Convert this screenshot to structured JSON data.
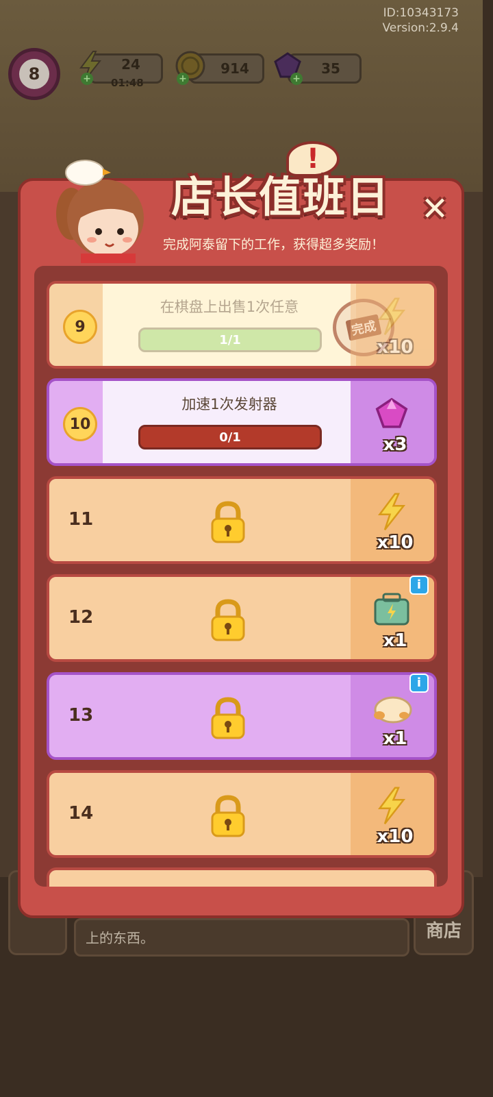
{
  "meta": {
    "id": "ID:10343173",
    "version": "Version:2.9.4"
  },
  "top_bar": {
    "level": "8",
    "energy": "24",
    "energy_timer": "01:48",
    "coins": "914",
    "gems": "35"
  },
  "panel": {
    "title": "店长值班日",
    "subtitle": "完成阿泰留下的工作，获得超多奖励！",
    "alert": "!",
    "close_label": "✕"
  },
  "tasks": [
    {
      "number": "9",
      "description": "在棋盘上出售1次任意",
      "progress": "1/1",
      "progress_fraction": 1.0,
      "status": "完成",
      "reward_icon": "energy-icon",
      "reward_qty": "x10"
    },
    {
      "number": "10",
      "description": "加速1次发射器",
      "progress": "0/1",
      "progress_fraction": 0.0,
      "reward_icon": "gem-icon",
      "reward_qty": "x3"
    },
    {
      "number": "11",
      "locked": true,
      "reward_icon": "energy-icon",
      "reward_qty": "x10"
    },
    {
      "number": "12",
      "locked": true,
      "reward_icon": "energy-chest-icon",
      "reward_qty": "x1"
    },
    {
      "number": "13",
      "locked": true,
      "reward_icon": "bread-icon",
      "reward_qty": "x1"
    },
    {
      "number": "14",
      "locked": true,
      "reward_icon": "energy-icon",
      "reward_qty": "x10"
    }
  ],
  "bottom": {
    "text": "上的东西。",
    "right_button": "商店"
  },
  "colors": {
    "panel": "#c8504a",
    "orange_card": "#f8cfa0",
    "purple_card": "#e2aef2",
    "progress_bar": "#b33a2a"
  }
}
